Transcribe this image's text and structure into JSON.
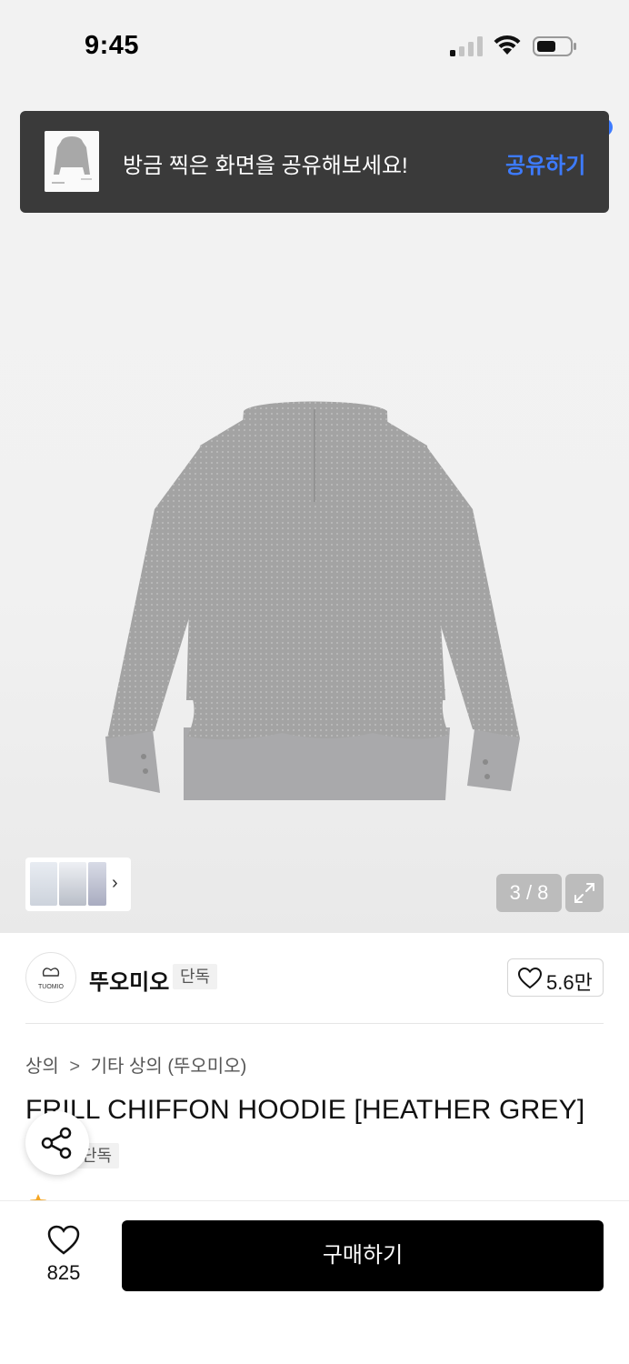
{
  "status_bar": {
    "time": "9:45"
  },
  "toast": {
    "message": "방금 찍은 화면을 공유해보세요!",
    "action": "공유하기"
  },
  "gallery": {
    "counter": "3 / 8",
    "thumb_arrow": "›"
  },
  "brand": {
    "name": "뚜오미오",
    "logo_text": "TUOMIO",
    "badge": "단독",
    "likes": "5.6만"
  },
  "breadcrumb": {
    "level1": "상의",
    "separator": ">",
    "level2": "기타 상의 (뚜오미오)"
  },
  "product": {
    "title": "FRILL CHIFFON HOODIE [HEATHER GREY]",
    "badge": "단독"
  },
  "bottom_bar": {
    "wish_count": "825",
    "buy_label": "구매하기"
  },
  "colors": {
    "toast_bg": "#3a3a3a",
    "accent_blue": "#3d7bff",
    "buy_button": "#000000",
    "product_grey": "#9b9b9b"
  }
}
